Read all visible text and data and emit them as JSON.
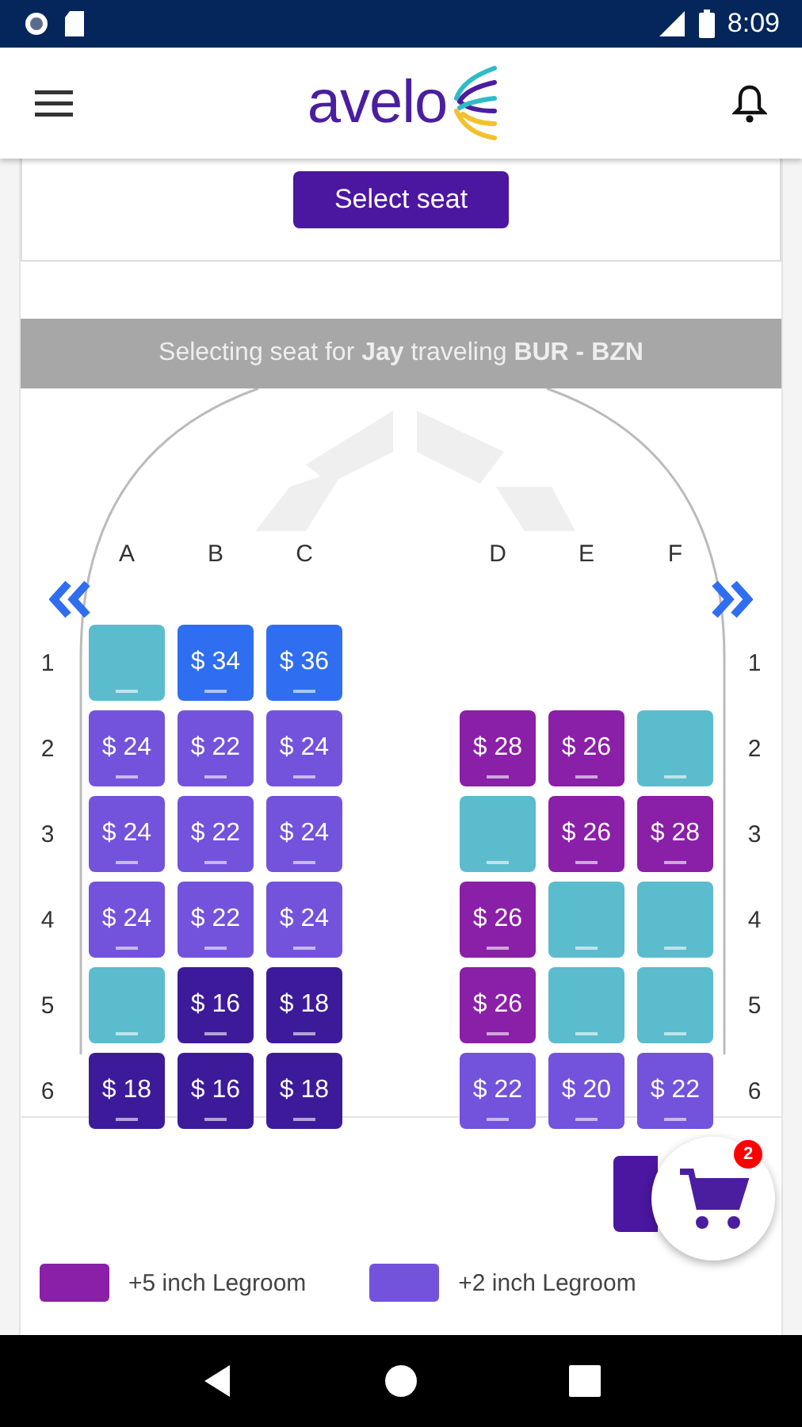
{
  "status_bar": {
    "time": "8:09"
  },
  "app_bar": {
    "logo": "avelo"
  },
  "select_button": "Select seat",
  "banner": "Selecting seat for **Jay** traveling **BUR - BZN**",
  "columns": [
    "A",
    "B",
    "C",
    "D",
    "E",
    "F"
  ],
  "rows": [
    {
      "left_label": "1",
      "right_label": "1",
      "seats": [
        {
          "kind": "open"
        },
        {
          "kind": "front",
          "price": "$ 34"
        },
        {
          "kind": "front",
          "price": "$ 36"
        },
        {
          "kind": "empty"
        },
        {
          "kind": "empty"
        },
        {
          "kind": "empty"
        }
      ]
    },
    {
      "left_label": "2",
      "right_label": "2",
      "seats": [
        {
          "kind": "plus2",
          "price": "$ 24"
        },
        {
          "kind": "plus2",
          "price": "$ 22"
        },
        {
          "kind": "plus2",
          "price": "$ 24"
        },
        {
          "kind": "plus5",
          "price": "$ 28"
        },
        {
          "kind": "plus5",
          "price": "$ 26"
        },
        {
          "kind": "open"
        }
      ]
    },
    {
      "left_label": "3",
      "right_label": "3",
      "seats": [
        {
          "kind": "plus2",
          "price": "$ 24"
        },
        {
          "kind": "plus2",
          "price": "$ 22"
        },
        {
          "kind": "plus2",
          "price": "$ 24"
        },
        {
          "kind": "open"
        },
        {
          "kind": "plus5",
          "price": "$ 26"
        },
        {
          "kind": "plus5",
          "price": "$ 28"
        }
      ]
    },
    {
      "left_label": "4",
      "right_label": "4",
      "seats": [
        {
          "kind": "plus2",
          "price": "$ 24"
        },
        {
          "kind": "plus2",
          "price": "$ 22"
        },
        {
          "kind": "plus2",
          "price": "$ 24"
        },
        {
          "kind": "plus5",
          "price": "$ 26"
        },
        {
          "kind": "open"
        },
        {
          "kind": "open"
        }
      ]
    },
    {
      "left_label": "5",
      "right_label": "5",
      "seats": [
        {
          "kind": "open"
        },
        {
          "kind": "standard",
          "price": "$ 16"
        },
        {
          "kind": "standard",
          "price": "$ 18"
        },
        {
          "kind": "plus5",
          "price": "$ 26"
        },
        {
          "kind": "open"
        },
        {
          "kind": "open"
        }
      ]
    },
    {
      "left_label": "6",
      "right_label": "6",
      "seats": [
        {
          "kind": "standard",
          "price": "$ 18"
        },
        {
          "kind": "standard",
          "price": "$ 16"
        },
        {
          "kind": "standard",
          "price": "$ 18"
        },
        {
          "kind": "plus2",
          "price": "$ 22"
        },
        {
          "kind": "plus2",
          "price": "$ 20"
        },
        {
          "kind": "plus2",
          "price": "$ 22"
        }
      ]
    }
  ],
  "cart": {
    "badge": "2"
  },
  "legend": [
    {
      "label": "+5 inch Legroom",
      "color": "#8a1fa8"
    },
    {
      "label": "+2 inch Legroom",
      "color": "#7352dc"
    }
  ]
}
